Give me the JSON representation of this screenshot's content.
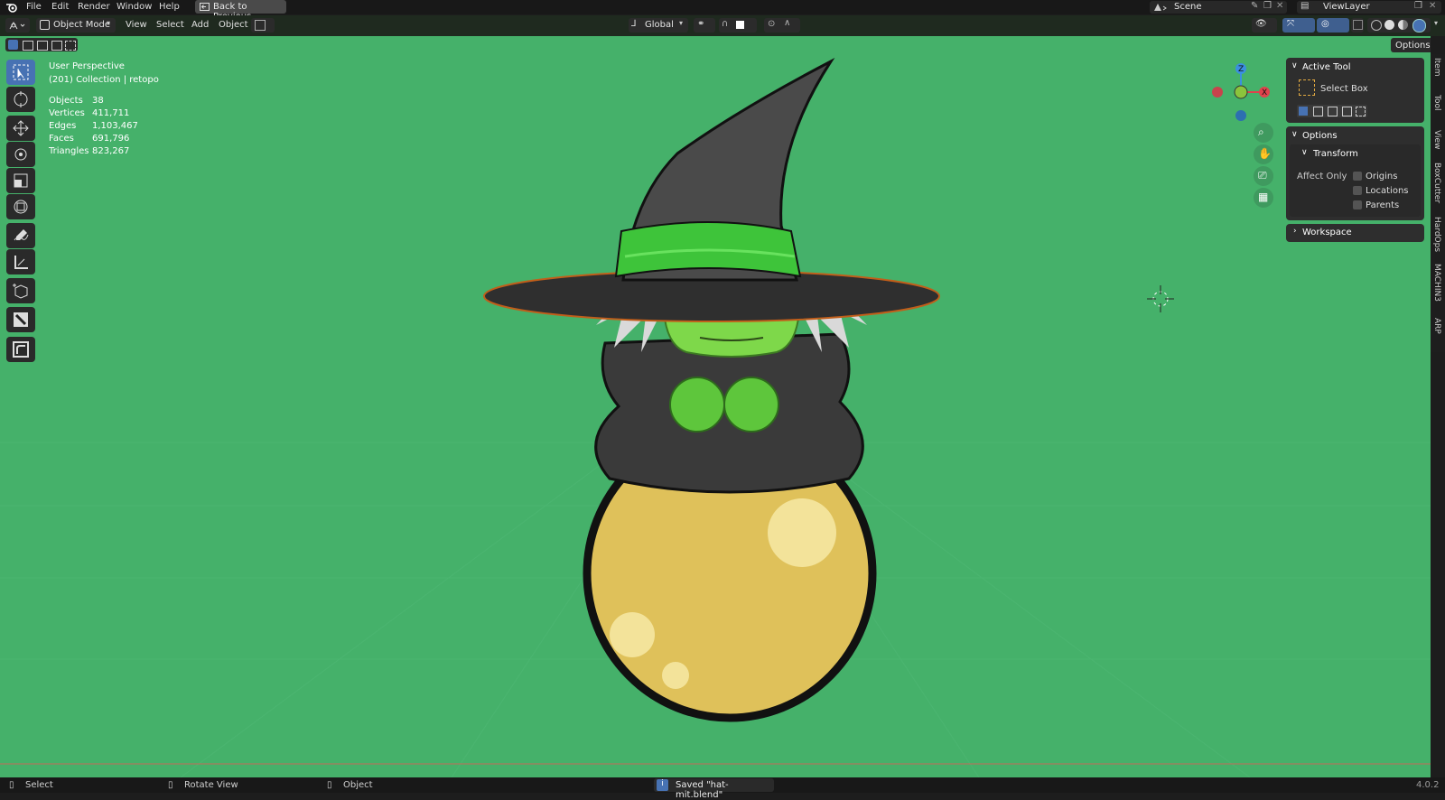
{
  "topbar": {
    "menus": [
      "File",
      "Edit",
      "Render",
      "Window",
      "Help"
    ],
    "back_button": "Back to Previous",
    "scene": "Scene",
    "view_layer": "ViewLayer"
  },
  "header": {
    "mode": "Object Mode",
    "menus": [
      "View",
      "Select",
      "Add",
      "Object"
    ],
    "orientation": "Global",
    "options": "Options"
  },
  "overlay": {
    "perspective": "User Perspective",
    "collection": "(201) Collection | retopo",
    "stats": [
      {
        "label": "Objects",
        "value": "38"
      },
      {
        "label": "Vertices",
        "value": "411,711"
      },
      {
        "label": "Edges",
        "value": "1,103,467"
      },
      {
        "label": "Faces",
        "value": "691,796"
      },
      {
        "label": "Triangles",
        "value": "823,267"
      }
    ]
  },
  "gizmo": {
    "z": "Z",
    "x": "X"
  },
  "npanel": {
    "active_tool_title": "Active Tool",
    "active_tool_name": "Select Box",
    "options_title": "Options",
    "transform_title": "Transform",
    "affect_only": "Affect Only",
    "checkboxes": [
      "Origins",
      "Locations",
      "Parents"
    ],
    "workspace_title": "Workspace"
  },
  "side_tabs": [
    "Item",
    "Tool",
    "View",
    "BoxCutter",
    "HardOps",
    "MACHIN3",
    "ARP"
  ],
  "status": {
    "select": "Select",
    "rotate": "Rotate View",
    "object": "Object",
    "message": "Saved \"hat-mit.blend\"",
    "version": "4.0.2"
  },
  "colors": {
    "viewport_bg": "#45b16a",
    "accent": "#4772b3",
    "axis_x": "#e0424c",
    "axis_y": "#8bc43c",
    "axis_z": "#3b8fe0"
  }
}
